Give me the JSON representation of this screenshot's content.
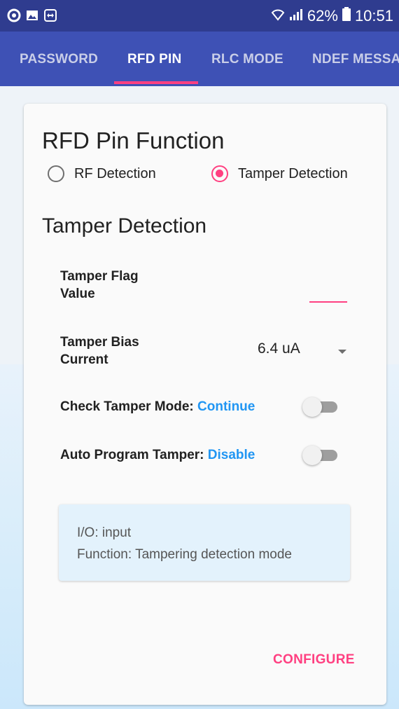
{
  "status_bar": {
    "signal_text": "62%",
    "time": "10:51",
    "icons": [
      "app-icon",
      "gallery-icon",
      "teamviewer-icon",
      "wifi-icon",
      "signal-icon",
      "battery-icon"
    ]
  },
  "tabs": [
    {
      "label": "PASSWORD",
      "selected": false
    },
    {
      "label": "RFD PIN",
      "selected": true
    },
    {
      "label": "RLC MODE",
      "selected": false
    },
    {
      "label": "NDEF MESSA",
      "selected": false
    }
  ],
  "card": {
    "title": "RFD Pin Function",
    "radios": [
      {
        "label": "RF Detection",
        "checked": false
      },
      {
        "label": "Tamper Detection",
        "checked": true
      }
    ],
    "section_title": "Tamper Detection",
    "tamper_flag": {
      "label_line1": "Tamper Flag",
      "label_line2": "Value",
      "value": ""
    },
    "tamper_bias": {
      "label_line1": "Tamper Bias",
      "label_line2": "Current",
      "selected": "6.4 uA"
    },
    "check_tamper": {
      "label": "Check Tamper Mode: ",
      "value": "Continue",
      "on": false
    },
    "auto_program": {
      "label": "Auto Program Tamper: ",
      "value": "Disable",
      "on": false
    },
    "info": {
      "line1": "I/O: input",
      "line2": "Function: Tampering detection mode"
    },
    "configure_label": "CONFIGURE"
  },
  "colors": {
    "primary": "#3e51b5",
    "primary_dark": "#2f3c8f",
    "accent": "#ff4081",
    "link": "#2196f3"
  }
}
